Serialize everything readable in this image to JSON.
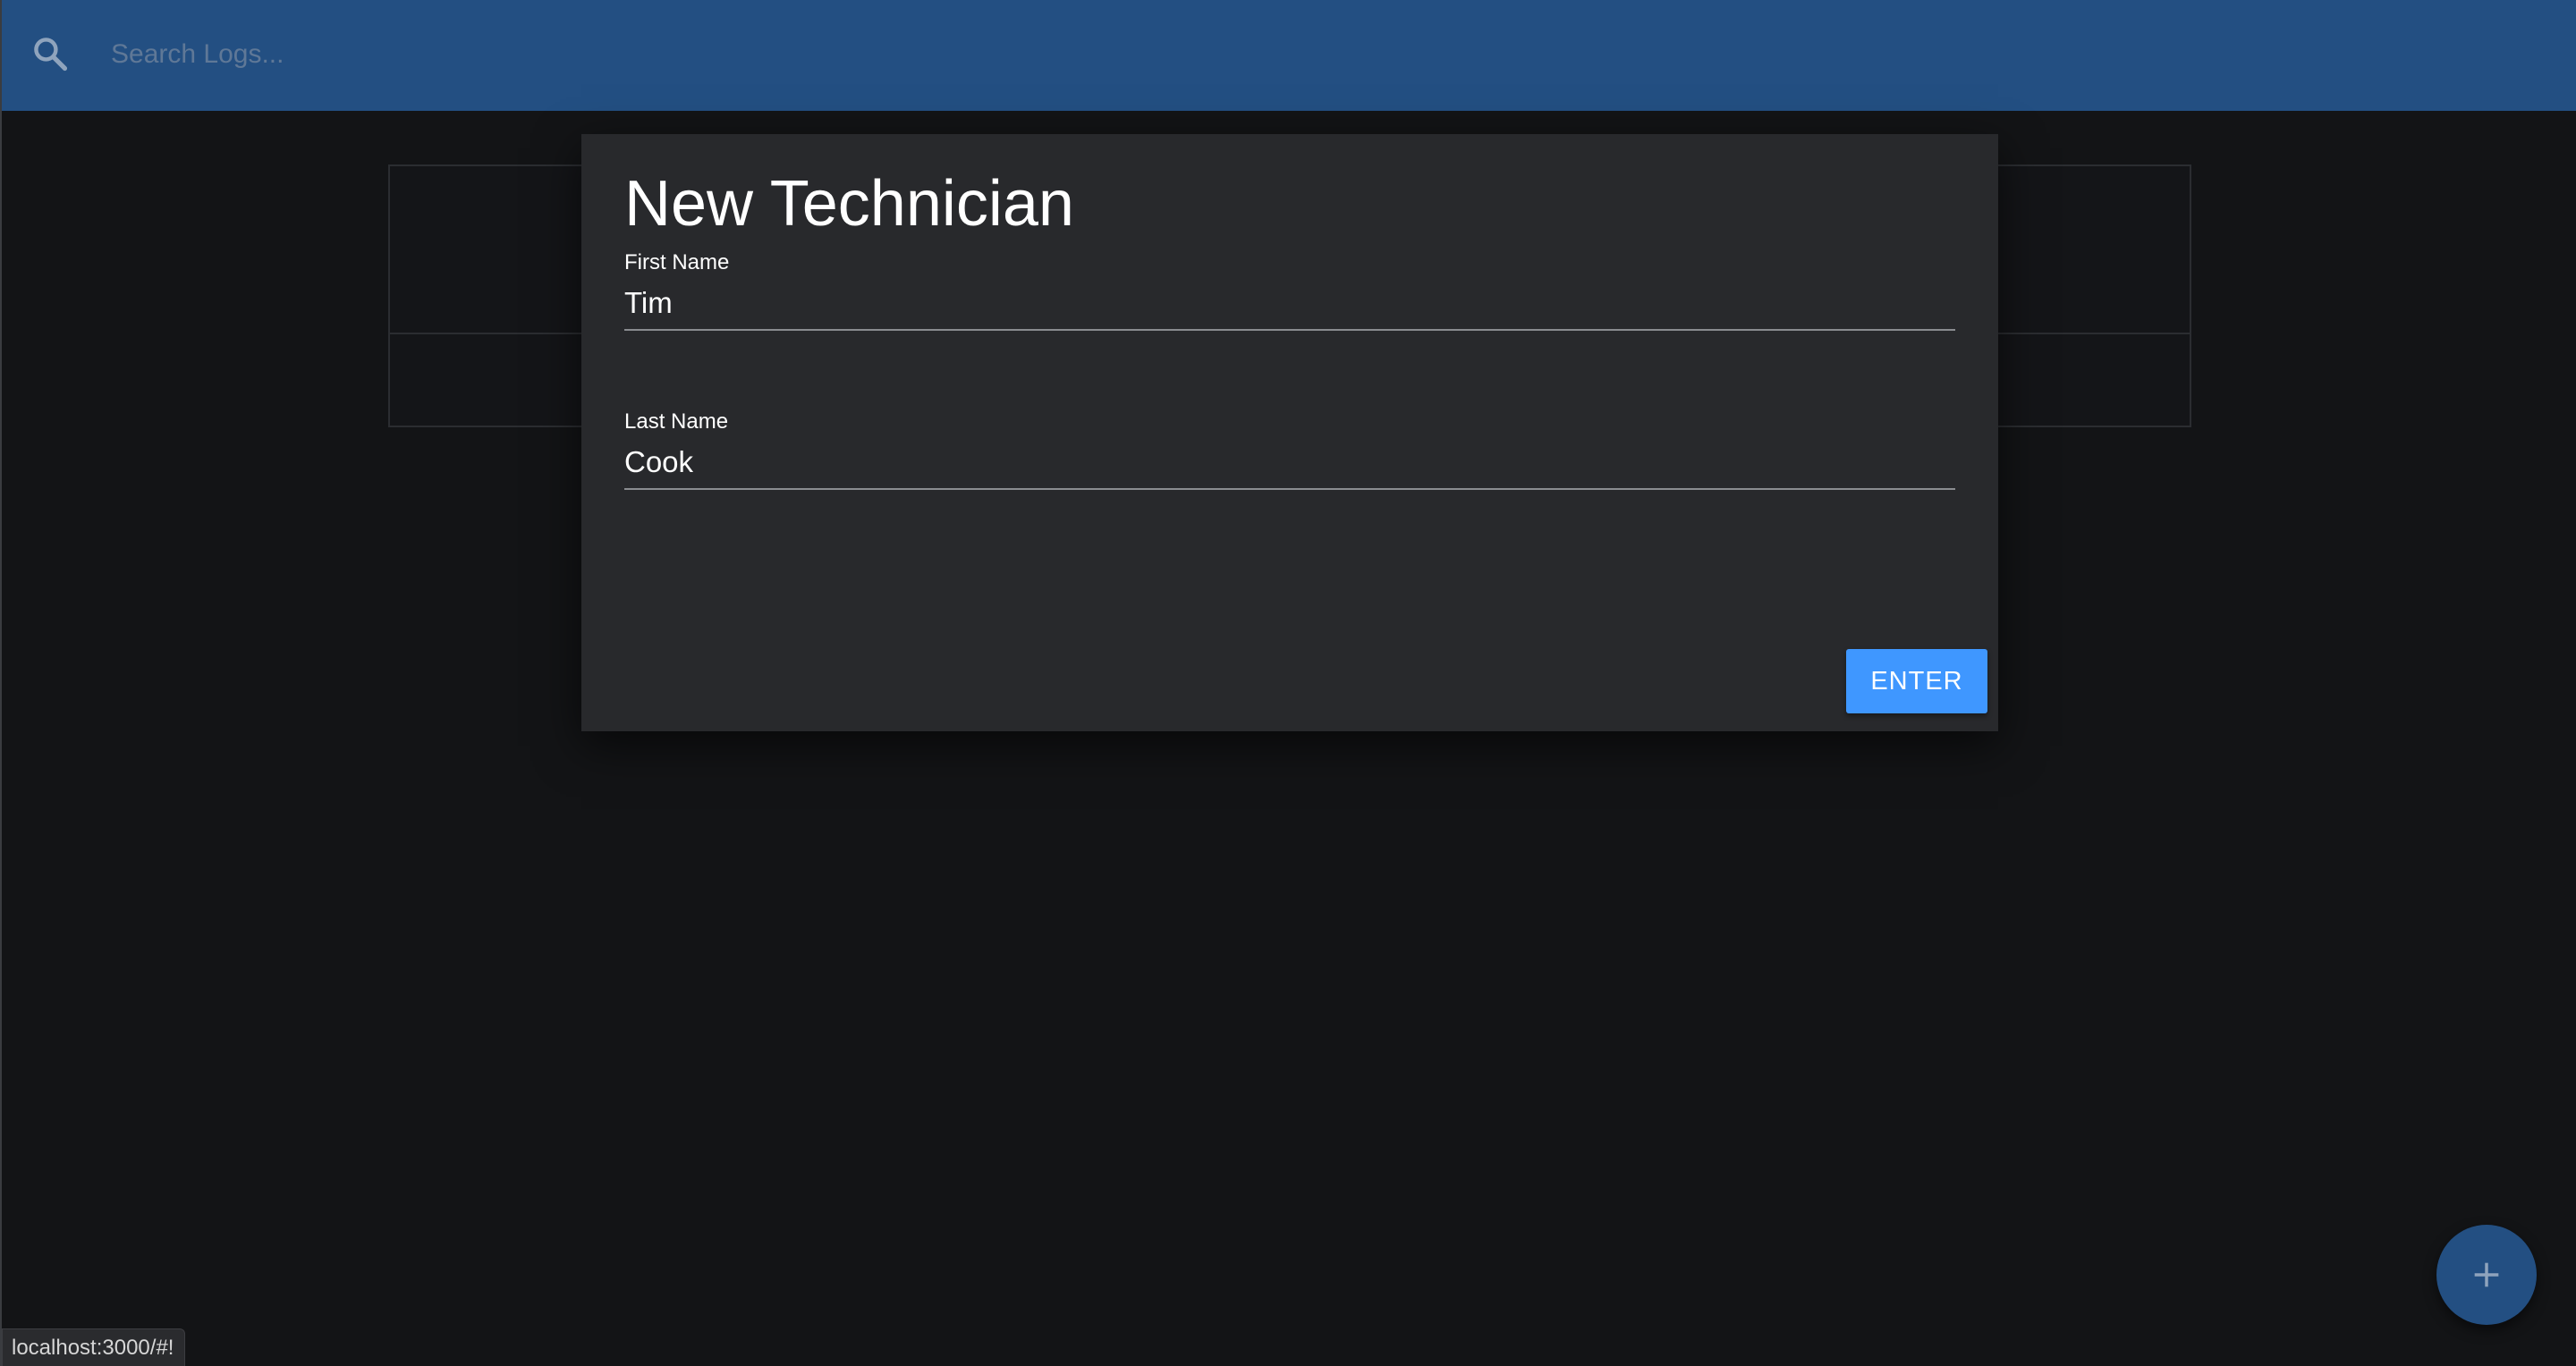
{
  "search": {
    "placeholder": "Search Logs...",
    "value": ""
  },
  "modal": {
    "title": "New Technician",
    "first_name": {
      "label": "First Name",
      "value": "Tim"
    },
    "last_name": {
      "label": "Last Name",
      "value": "Cook"
    },
    "enter_label": "ENTER"
  },
  "status_bar": {
    "url": "localhost:3000/#!"
  },
  "colors": {
    "navbar": "#234f82",
    "background": "#131416",
    "modal": "#28292c",
    "primary_button": "#3f97ff"
  },
  "icons": {
    "search": "search-icon",
    "add": "plus-icon"
  }
}
